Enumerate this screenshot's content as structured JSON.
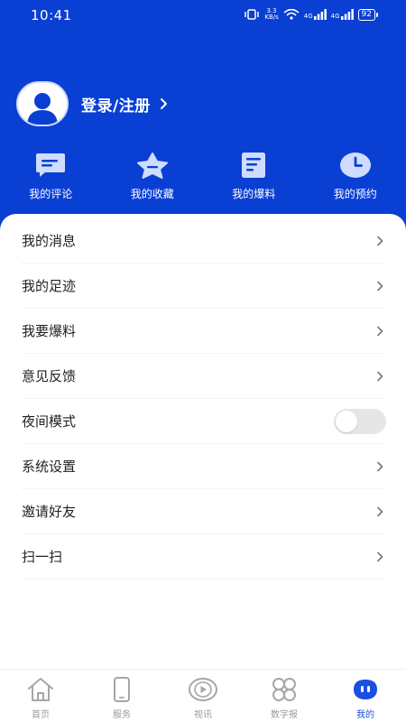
{
  "status_bar": {
    "time": "10:41",
    "network": "3.3\nKB/s",
    "signal1": "4G",
    "signal2": "4G",
    "battery": "92"
  },
  "profile": {
    "login_label": "登录/注册"
  },
  "quick_actions": [
    {
      "label": "我的评论",
      "icon": "comment-icon"
    },
    {
      "label": "我的收藏",
      "icon": "star-icon"
    },
    {
      "label": "我的爆料",
      "icon": "document-icon"
    },
    {
      "label": "我的预约",
      "icon": "clock-icon"
    }
  ],
  "menu": [
    {
      "label": "我的消息",
      "type": "link"
    },
    {
      "label": "我的足迹",
      "type": "link"
    },
    {
      "label": "我要爆料",
      "type": "link"
    },
    {
      "label": "意见反馈",
      "type": "link"
    },
    {
      "label": "夜间模式",
      "type": "toggle",
      "enabled": false
    },
    {
      "label": "系统设置",
      "type": "link"
    },
    {
      "label": "邀请好友",
      "type": "link"
    },
    {
      "label": "扫一扫",
      "type": "link"
    }
  ],
  "tabs": [
    {
      "label": "首页",
      "icon": "home-icon",
      "active": false
    },
    {
      "label": "服务",
      "icon": "phone-icon",
      "active": false
    },
    {
      "label": "视讯",
      "icon": "play-icon",
      "active": false
    },
    {
      "label": "数字报",
      "icon": "grid-icon",
      "active": false
    },
    {
      "label": "我的",
      "icon": "profile-face-icon",
      "active": true
    }
  ],
  "colors": {
    "brand_blue": "#0a3fd4",
    "active_tab": "#1b4fe0",
    "inactive_tab": "#9a9a9a"
  }
}
